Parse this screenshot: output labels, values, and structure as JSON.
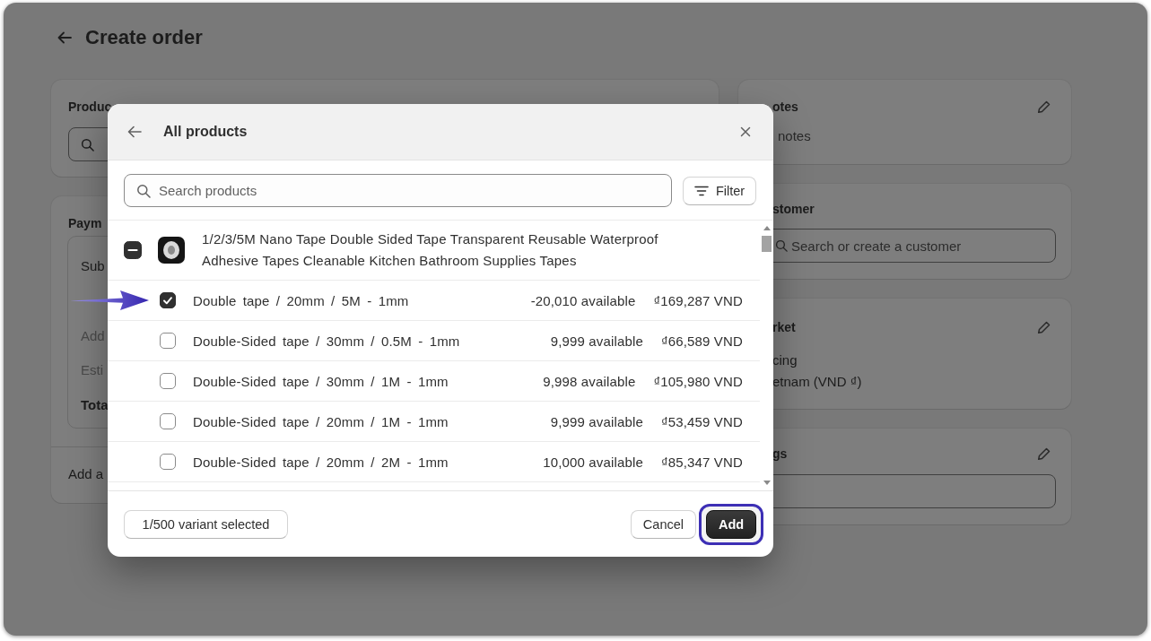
{
  "page": {
    "title": "Create order"
  },
  "products_card": {
    "title": "Produc"
  },
  "payment_card": {
    "title": "Paym",
    "summary": [
      {
        "label": "Sub",
        "kind": "normal"
      },
      {
        "label": "Add",
        "kind": "muted"
      },
      {
        "label": "Esti",
        "kind": "muted"
      },
      {
        "label": "Tota",
        "kind": "total"
      }
    ],
    "footer": "Add a"
  },
  "notes_card": {
    "title": "otes",
    "text": "notes"
  },
  "customer_card": {
    "title": "stomer",
    "search": {
      "placeholder": "Search or create a customer"
    }
  },
  "market_card": {
    "title": "rket",
    "label": "cing",
    "value": "etnam (VND ₫)"
  },
  "tags_card": {
    "title": "gs"
  },
  "dialog": {
    "title": "All products",
    "search": {
      "placeholder": "Search products"
    },
    "filter": "Filter",
    "product": {
      "title": "1/2/3/5M Nano Tape Double Sided Tape Transparent Reusable Waterproof Adhesive Tapes Cleanable Kitchen Bathroom Supplies Tapes",
      "indeterminate": true,
      "variants": [
        {
          "name": "Double tape / 20mm / 5M - 1mm",
          "available": "-20,010 available",
          "price": "₫169,287 VND",
          "checked": true,
          "pointed": true
        },
        {
          "name": "Double-Sided tape / 30mm / 0.5M - 1mm",
          "available": "9,999 available",
          "price": "₫66,589 VND",
          "checked": false,
          "pointed": false
        },
        {
          "name": "Double-Sided tape / 30mm / 1M - 1mm",
          "available": "9,998 available",
          "price": "₫105,980 VND",
          "checked": false,
          "pointed": false
        },
        {
          "name": "Double-Sided tape / 20mm / 1M - 1mm",
          "available": "9,999 available",
          "price": "₫53,459 VND",
          "checked": false,
          "pointed": false
        },
        {
          "name": "Double-Sided tape / 20mm / 2M - 1mm",
          "available": "10,000 available",
          "price": "₫85,347 VND",
          "checked": false,
          "pointed": false
        }
      ]
    },
    "footer": {
      "selection": "1/500 variant selected",
      "buttons": [
        {
          "label": "Cancel",
          "kind": "secondary",
          "highlighted": false
        },
        {
          "label": "Add",
          "kind": "primary",
          "highlighted": true
        }
      ]
    }
  }
}
